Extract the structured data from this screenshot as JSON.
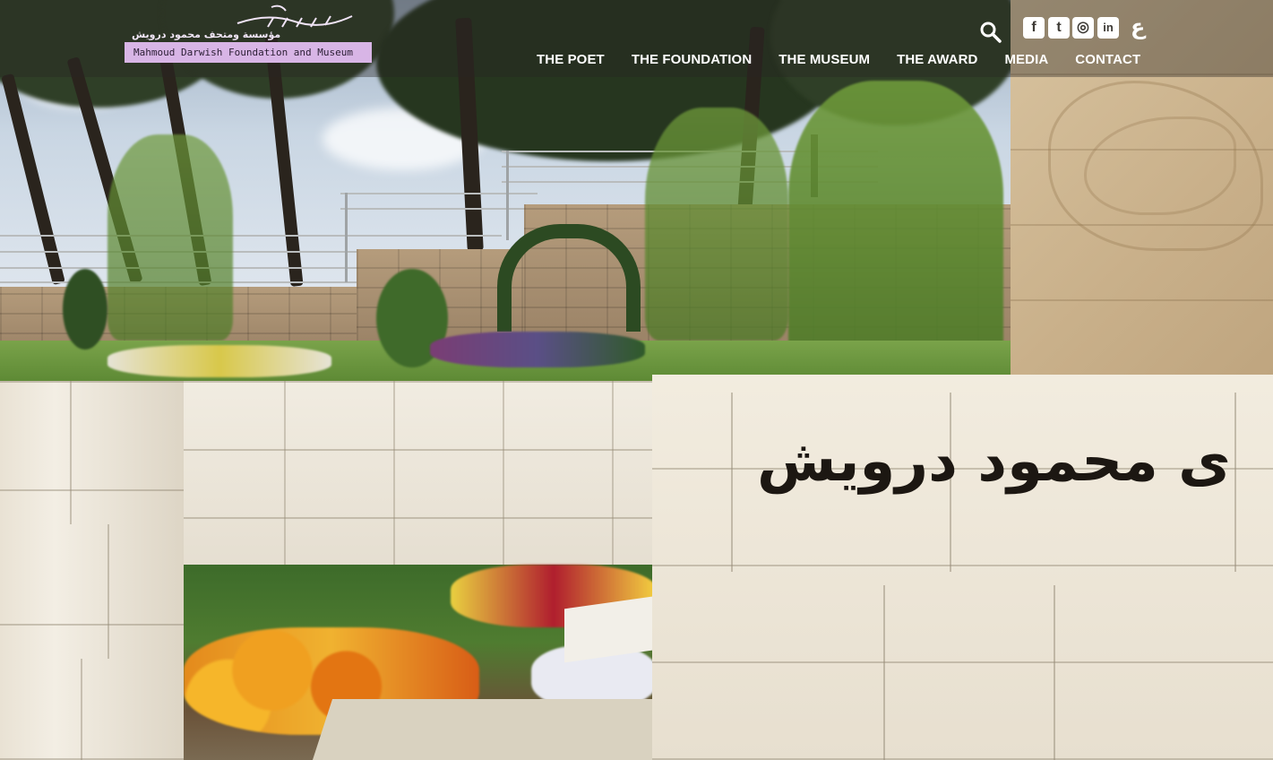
{
  "site": {
    "logo": {
      "arabic_name": "مؤسسة ومتحف محمود درويش",
      "english_name": "Mahmoud Darwish Foundation and Museum",
      "accent_color": "#d8b5e6"
    },
    "nav": [
      {
        "label": "THE POET"
      },
      {
        "label": "THE FOUNDATION"
      },
      {
        "label": "THE MUSEUM"
      },
      {
        "label": "THE AWARD"
      },
      {
        "label": "MEDIA"
      },
      {
        "label": "CONTACT"
      }
    ],
    "utility": {
      "search_icon": "search-icon",
      "social": [
        {
          "icon": "facebook-icon",
          "glyph": "f"
        },
        {
          "icon": "twitter-icon",
          "glyph": "t"
        },
        {
          "icon": "instagram-icon",
          "glyph": "◎"
        },
        {
          "icon": "linkedin-icon",
          "glyph": "in"
        }
      ],
      "language_toggle": "ع"
    }
  },
  "hero": {
    "sign_text": "ى محمود درويش"
  }
}
